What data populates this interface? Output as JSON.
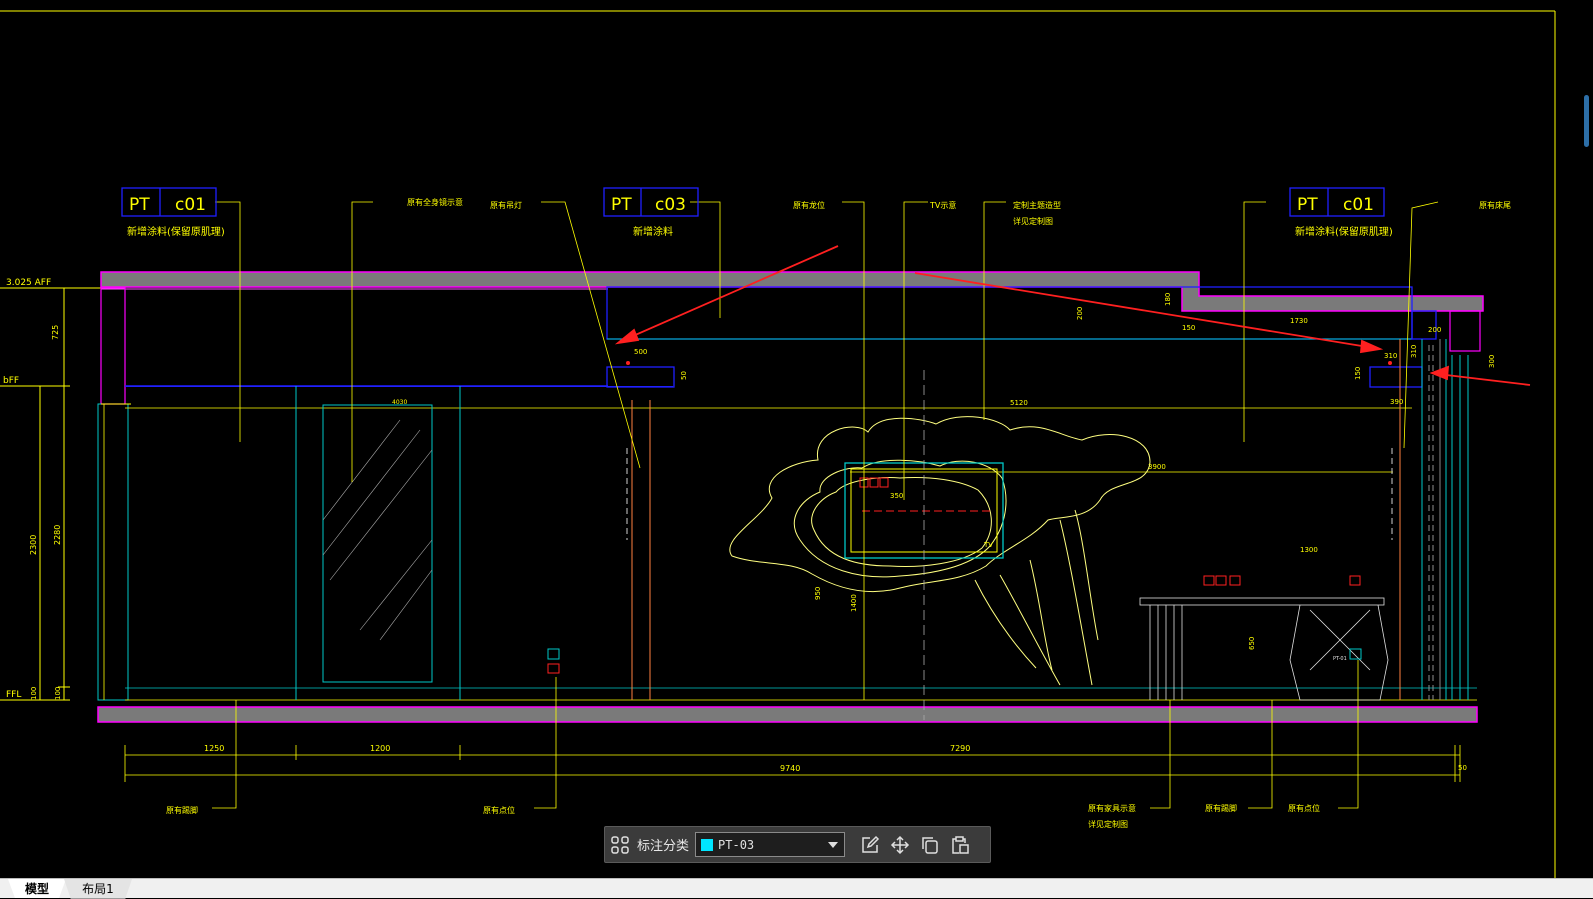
{
  "drawing": {
    "level_aff": "3.025 AFF",
    "level_bff": "bFF",
    "level_ffl": "FFL",
    "tags": [
      {
        "code": "PT",
        "num": "c01",
        "note": "新增涂料(保留原肌理)"
      },
      {
        "code": "PT",
        "num": "c03",
        "note": "新增涂料"
      },
      {
        "code": "PT",
        "num": "c01",
        "note": "新增涂料(保留原肌理)"
      }
    ],
    "callouts_top": [
      "原有全身镜示意",
      "原有吊灯",
      "原有龙位",
      "TV示意",
      "定制主题造型",
      "详见定制图",
      "原有床尾"
    ],
    "callouts_bottom": [
      "原有踢脚",
      "原有点位",
      "原有家具示意",
      "详见定制图",
      "原有踢脚",
      "原有点位"
    ],
    "dims_bottom": [
      "1250",
      "1200",
      "7290",
      "9740",
      "50"
    ],
    "dims_left": [
      "725",
      "2300",
      "2280",
      "100",
      "100"
    ],
    "dims_misc": [
      "4030",
      "5120",
      "3900",
      "1730",
      "350",
      "1400",
      "950",
      "200",
      "310",
      "50",
      "180",
      "150",
      "150",
      "1300",
      "650",
      "310",
      "200",
      "300",
      "390",
      "500"
    ],
    "tv_label": "TV",
    "furniture_label": "PT-01"
  },
  "toolbar": {
    "label": "标注分类",
    "selected": "PT-03",
    "swatch_color": "#00e5ff",
    "icons": [
      "grid-icon",
      "edit-icon",
      "move-icon",
      "copy-icon",
      "paste-icon"
    ]
  },
  "tabs": [
    {
      "label": "模型",
      "active": true
    },
    {
      "label": "布局1",
      "active": false
    }
  ],
  "colors": {
    "background": "#000000",
    "yellow": "#ffff00",
    "cyan": "#00c8c8",
    "magenta": "#ff00ff",
    "blue": "#2020ff",
    "red": "#ff2020",
    "grey_fill": "#7a7a7a"
  }
}
